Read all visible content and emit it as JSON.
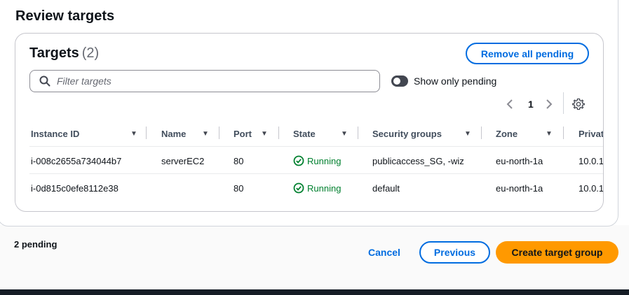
{
  "page": {
    "section_title": "Review targets",
    "footer_pending": "2 pending"
  },
  "targets": {
    "heading": "Targets",
    "count": "(2)",
    "remove_all_label": "Remove all pending",
    "filter_placeholder": "Filter targets",
    "toggle_label": "Show only pending",
    "toggle_on": false,
    "page_number": "1"
  },
  "table": {
    "columns": [
      "Instance ID",
      "Name",
      "Port",
      "State",
      "Security groups",
      "Zone",
      "Privat"
    ],
    "rows": [
      {
        "instance_id": "i-008c2655a734044b7",
        "name": "serverEC2",
        "port": "80",
        "state": "Running",
        "security_groups": "publicaccess_SG, -wiz",
        "zone": "eu-north-1a",
        "private_ip": "10.0.1"
      },
      {
        "instance_id": "i-0d815c0efe8112e38",
        "name": "",
        "port": "80",
        "state": "Running",
        "security_groups": "default",
        "zone": "eu-north-1a",
        "private_ip": "10.0.1"
      }
    ]
  },
  "actions": {
    "cancel_label": "Cancel",
    "previous_label": "Previous",
    "create_label": "Create target group"
  },
  "colors": {
    "primary": "#006ce0",
    "create_button": "#ff9900",
    "running": "#00802f",
    "text": "#0f141a"
  },
  "icons": {
    "search": "search-icon",
    "prev": "chevron-left-icon",
    "next": "chevron-right-icon",
    "settings": "gear-icon",
    "sort": "caret-down-icon",
    "status": "check-circle-icon"
  }
}
